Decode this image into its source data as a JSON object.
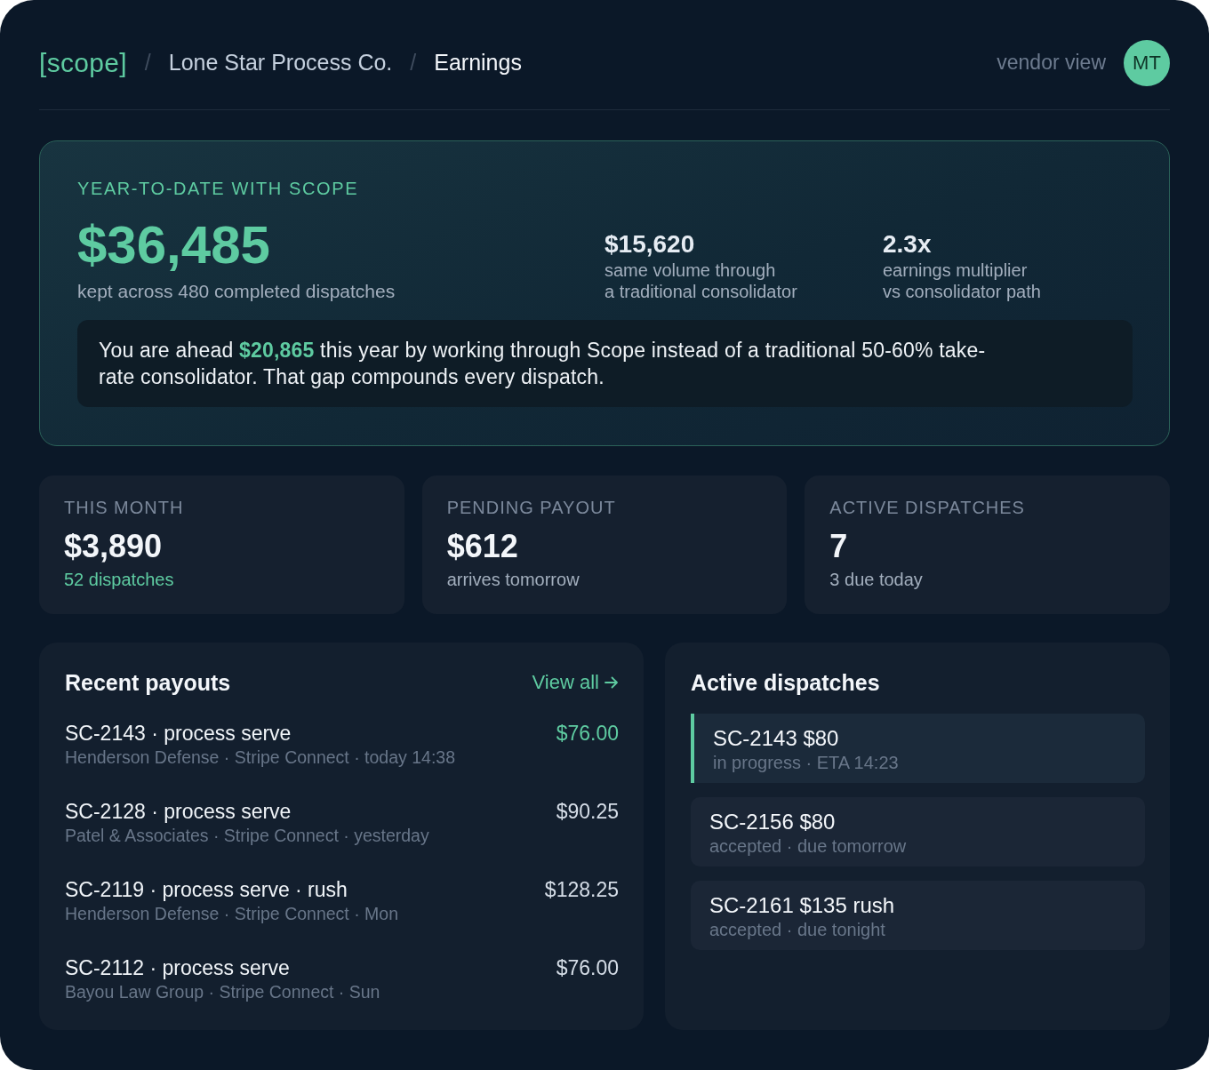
{
  "header": {
    "brand": "[scope]",
    "breadcrumbs": [
      {
        "separator": "/",
        "label": "Lone Star Process Co.",
        "selected": false
      },
      {
        "separator": "/",
        "label": "Earnings",
        "selected": true
      }
    ],
    "view_label": "vendor view",
    "avatar": {
      "initials": "MT"
    }
  },
  "hero": {
    "eyebrow": "YEAR-TO-DATE WITH SCOPE",
    "amount": "$36,485",
    "caption": "kept across 480 completed dispatches",
    "comparisons": [
      {
        "value": "$15,620",
        "caption": "same volume through\na traditional consolidator"
      },
      {
        "value": "2.3x",
        "caption": "earnings multiplier\nvs consolidator path"
      }
    ],
    "callout": "You are ahead **$20,865** this year by working through Scope instead of a traditional 50-60% take-rate consolidator. That gap compounds every dispatch."
  },
  "stats": [
    {
      "label": "THIS MONTH",
      "value": "$3,890",
      "note": "52 dispatches",
      "highlight": true
    },
    {
      "label": "PENDING PAYOUT",
      "value": "$612",
      "note": "arrives tomorrow",
      "highlight": false
    },
    {
      "label": "ACTIVE DISPATCHES",
      "value": "7",
      "note": "3 due today",
      "highlight": false
    }
  ],
  "recent_payouts": {
    "title": "Recent payouts",
    "link": "View all",
    "items": [
      {
        "title": "SC-2143 · process serve",
        "meta": "Henderson Defense · Stripe Connect · today 14:38",
        "amount": "$76.00",
        "highlight": true
      },
      {
        "title": "SC-2128 · process serve",
        "meta": "Patel & Associates · Stripe Connect · yesterday",
        "amount": "$90.25",
        "highlight": false
      },
      {
        "title": "SC-2119 · process serve · rush",
        "meta": "Henderson Defense · Stripe Connect · Mon",
        "amount": "$128.25",
        "highlight": false
      },
      {
        "title": "SC-2112 · process serve",
        "meta": "Bayou Law Group · Stripe Connect · Sun",
        "amount": "$76.00",
        "highlight": false
      }
    ]
  },
  "active_dispatches": {
    "title": "Active dispatches",
    "items": [
      {
        "title": "SC-2143 $80",
        "status": "in progress · ETA 14:23",
        "active": true
      },
      {
        "title": "SC-2156 $80",
        "status": "accepted · due tomorrow",
        "active": false
      },
      {
        "title": "SC-2161 $135 rush",
        "status": "accepted · due tonight",
        "active": false
      }
    ]
  }
}
